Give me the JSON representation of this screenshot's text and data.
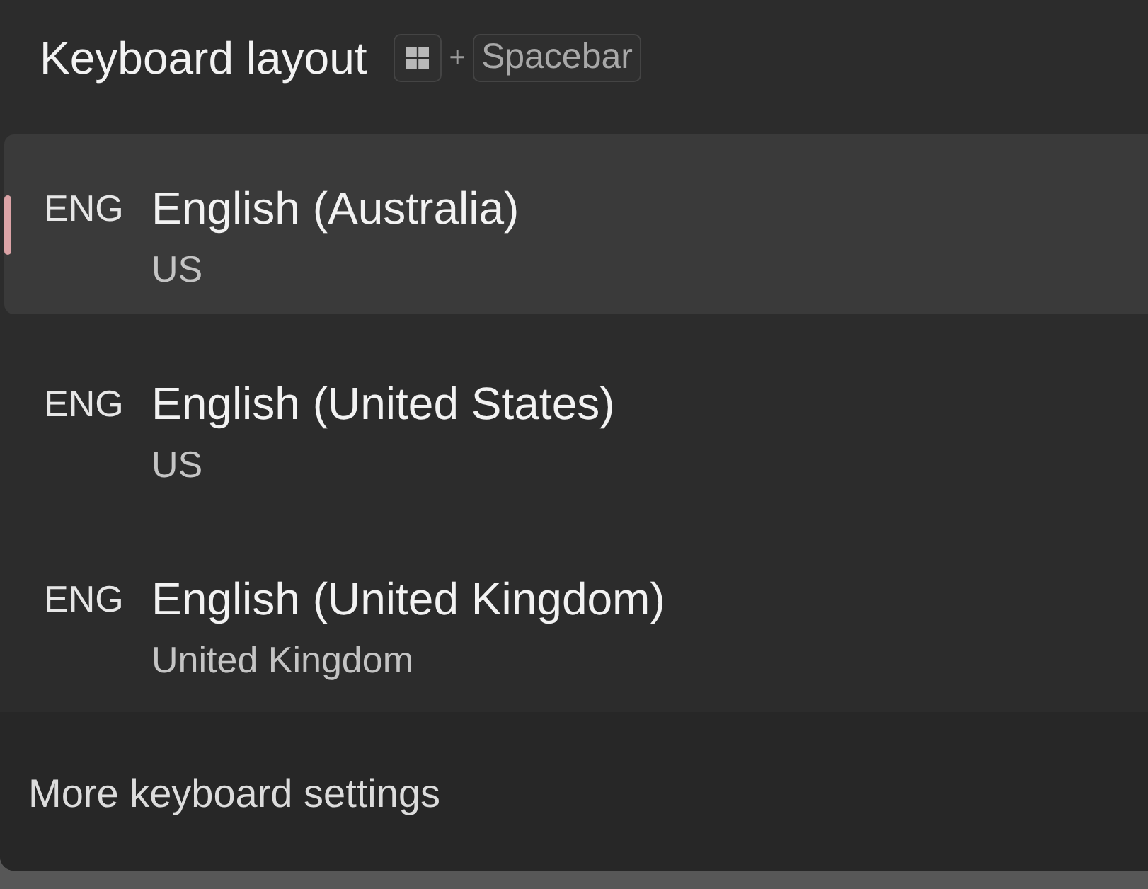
{
  "flyout": {
    "title": "Keyboard layout",
    "shortcut": {
      "keys": [
        {
          "kind": "windows"
        },
        {
          "kind": "text",
          "label": "Spacebar"
        }
      ],
      "separator": "+"
    }
  },
  "layouts": [
    {
      "code": "ENG",
      "name": "English (Australia)",
      "layout": "US",
      "selected": true
    },
    {
      "code": "ENG",
      "name": "English (United States)",
      "layout": "US",
      "selected": false
    },
    {
      "code": "ENG",
      "name": "English (United Kingdom)",
      "layout": "United Kingdom",
      "selected": false
    }
  ],
  "footer": {
    "link": "More keyboard settings"
  }
}
